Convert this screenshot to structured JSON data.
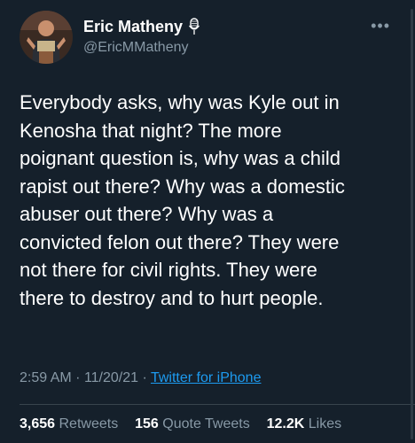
{
  "author": {
    "display_name": "Eric Matheny",
    "handle": "@EricMMatheny",
    "verified_icon": "microphone-icon",
    "avatar": "profile-photo"
  },
  "more_icon": "more-options-icon",
  "tweet": {
    "lines": [
      "Everybody asks, why was Kyle out in",
      "Kenosha that night? The more",
      "poignant question is, why was a child",
      "rapist out there? Why was a domestic",
      "abuser out there? Why was a",
      "convicted felon out there? They were",
      "not there for civil rights. They were",
      "there to destroy and to hurt people."
    ]
  },
  "meta": {
    "time": "2:59 AM",
    "separator": "·",
    "date": "11/20/21",
    "separator2": "·",
    "source": "Twitter for iPhone"
  },
  "stats": {
    "retweets_count": "3,656",
    "retweets_label": "Retweets",
    "quotes_count": "156",
    "quotes_label": "Quote Tweets",
    "likes_count": "12.2K",
    "likes_label": "Likes"
  },
  "colors": {
    "background": "#15202b",
    "text_primary": "#ffffff",
    "text_secondary": "#8899a6",
    "link": "#1d9bf0",
    "divider": "#38444d"
  }
}
